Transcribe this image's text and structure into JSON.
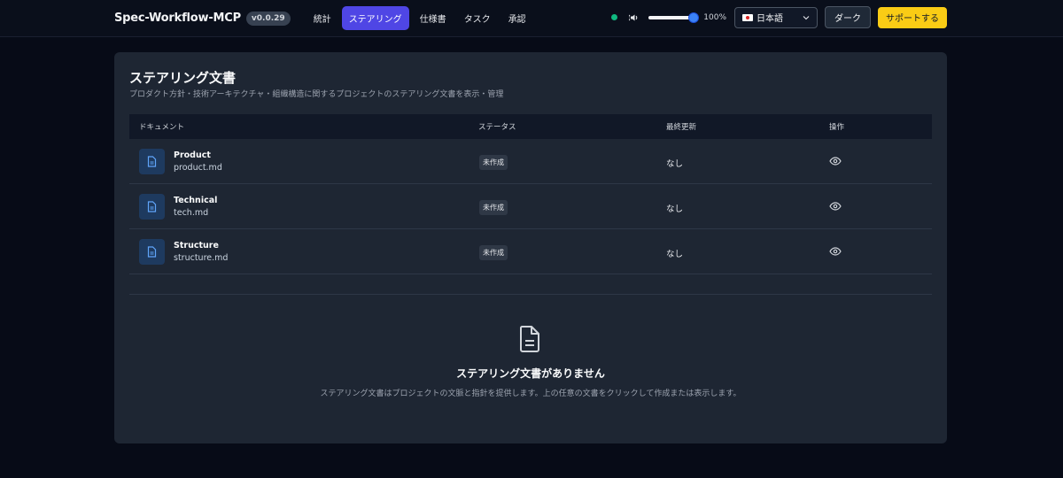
{
  "app": {
    "title": "Spec-Workflow-MCP",
    "version": "v0.0.29"
  },
  "nav": [
    {
      "label": "統計"
    },
    {
      "label": "ステアリング"
    },
    {
      "label": "仕様書"
    },
    {
      "label": "タスク"
    },
    {
      "label": "承認"
    }
  ],
  "controls": {
    "volume_percent": 100,
    "zoom_label": "100%",
    "language": "日本語",
    "theme_button": "ダーク",
    "support_button": "サポートする"
  },
  "page": {
    "title": "ステアリング文書",
    "subtitle": "プロダクト方針・技術アーキテクチャ・組織構造に関するプロジェクトのステアリング文書を表示・管理"
  },
  "table": {
    "headers": {
      "document": "ドキュメント",
      "status": "ステータス",
      "updated": "最終更新",
      "actions": "操作"
    },
    "rows": [
      {
        "name": "Product",
        "file": "product.md",
        "status": "未作成",
        "updated": "なし"
      },
      {
        "name": "Technical",
        "file": "tech.md",
        "status": "未作成",
        "updated": "なし"
      },
      {
        "name": "Structure",
        "file": "structure.md",
        "status": "未作成",
        "updated": "なし"
      }
    ]
  },
  "empty": {
    "title": "ステアリング文書がありません",
    "description": "ステアリング文書はプロジェクトの文脈と指針を提供します。上の任意の文書をクリックして作成または表示します。"
  },
  "colors": {
    "accent": "#4f46e5",
    "support": "#facc15",
    "status_online": "#10b981"
  }
}
